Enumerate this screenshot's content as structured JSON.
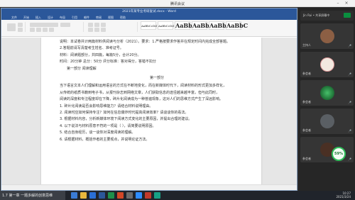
{
  "meeting": {
    "title": "腾讯会议",
    "user_status": "Jin Rui • 共享屏幕中"
  },
  "word": {
    "window_title": "2021年某专业考研复试.docx - Word",
    "menu": [
      "文件",
      "开始",
      "插入",
      "设计",
      "布局",
      "引用",
      "邮件",
      "审阅",
      "视图",
      "帮助"
    ],
    "styles": [
      "AaBbCcDd",
      "AaBbCcDd",
      "AaBbl",
      "AaBbC",
      "AaBbC",
      "AaBbC"
    ],
    "doc_lines_intro": [
      "说明：本试卷共计两篇材料供阅读与分析（2021）。要求：1.严格按要求作答并在规定时间内完成全部答题。",
      "2.答题前请写清楚考生姓名、准考证号。",
      "材料：阅读题部分，共四篇，每篇5分，合计20分。",
      "时间：20分钟   总分：50分   评分标准：答对得分，答错不扣分"
    ],
    "doc_line_reading_note": "     第一部分 阅读理解",
    "section_heading": "第一部分",
    "doc_lines_body": [
      "当下语言文本人们理解和运用语言的方式在不断地变化，而在新媒体时代下，阅读材料的形式更加多样化，",
      "从传统的纸质书籍到电子书，从报刊杂志到网络文章，人们获取信息的途径越来越丰富，但与此同时，",
      "阅读的深度和专注程度却在下降，碎片化阅读成为一种普遍现象，这对人们的思维方式产生了深远影响。",
      "1. 碎片化阅读是否会影响思维能力？请结合材料说明理由。",
      "2. 阅读时应如何保持专注？如何在信息爆炸时代提高阅读效率？请谈谈你的看法。",
      "3. 根据材料内容，分析新媒体环境下阅读方式变化的主要原因，并提出合理的建议。",
      "4. 以下说法与材料原意不符的一项是（  ），请简要说明原因。",
      "5. 结合自身经历，谈一谈你对深度阅读的理解。",
      "6. 请根据材料，概括作者的主要观点，并说明论证方法。"
    ]
  },
  "participants": [
    {
      "name": "主持人",
      "color": "#9c6b4a",
      "bg": "#7a5a48"
    },
    {
      "name": "参会者",
      "color": "#f1e5d8",
      "bg": "#e8d7c6"
    },
    {
      "name": "参会者",
      "color": "#3aa35b",
      "bg": "#2f2f2f"
    },
    {
      "name": "参会者",
      "color": "#555a5f",
      "bg": "#3e4246"
    },
    {
      "name": "参会者",
      "color": "#5a3a2a",
      "bg": "#2e2e2e"
    }
  ],
  "badge": {
    "value": "59%"
  },
  "taskbar": {
    "running_label": "1.7 第一章 一题多解的创意思维",
    "time": "10:27",
    "date": "2021/3/24"
  },
  "colors": {
    "word_blue": "#2b579a",
    "taskbar": "#20242b",
    "badge_green": "#2fbf5a"
  }
}
